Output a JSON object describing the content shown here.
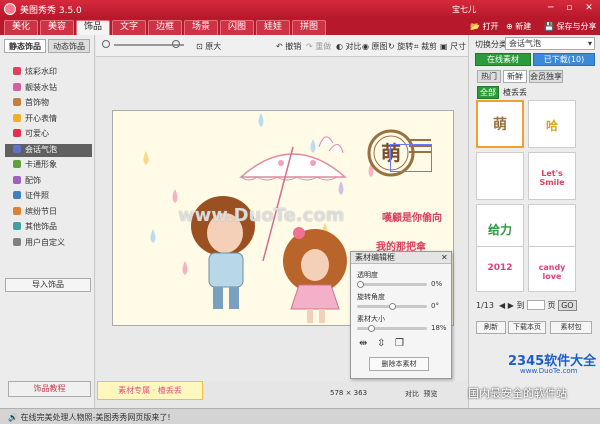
{
  "app": {
    "title": "美图秀秀 3.5.0",
    "user": "宝七儿",
    "win_controls": "─ ▫ ✕"
  },
  "menu": {
    "tabs": [
      "美化",
      "美容",
      "饰品",
      "文字",
      "边框",
      "场景",
      "闪图",
      "娃娃",
      "拼图"
    ],
    "active": 2,
    "open": "打开",
    "new": "新建",
    "save": "保存与分享"
  },
  "left": {
    "tab_static": "静态饰品",
    "tab_dynamic": "动态饰品",
    "categories": [
      {
        "label": "炫彩水印",
        "color": "#e04060"
      },
      {
        "label": "靓装水钻",
        "color": "#d060a0"
      },
      {
        "label": "首饰物",
        "color": "#c08040"
      },
      {
        "label": "开心表情",
        "color": "#f0b020"
      },
      {
        "label": "可爱心",
        "color": "#e03050"
      },
      {
        "label": "会话气泡",
        "color": "#6070d0"
      },
      {
        "label": "卡通形象",
        "color": "#60a040"
      },
      {
        "label": "配饰",
        "color": "#a060c0"
      },
      {
        "label": "证件照",
        "color": "#4080c0"
      },
      {
        "label": "缤纷节日",
        "color": "#e08030"
      },
      {
        "label": "其他饰品",
        "color": "#40a0a0"
      },
      {
        "label": "用户自定义",
        "color": "#808080"
      }
    ],
    "active_index": 5,
    "import": "导入饰品",
    "tutorial": "饰品教程",
    "banner": "素材专属 · 楂丢丢"
  },
  "toolbar": {
    "original": "原大",
    "undo": "撤销",
    "redo": "重做",
    "contrast": "对比",
    "original_view": "原图",
    "rotate": "旋转",
    "crop": "裁剪",
    "size": "尺寸"
  },
  "canvas": {
    "stamp_char": "萌",
    "text1": "嘆顧是你偷向",
    "text2": "我的那把傘",
    "watermark": "www.DuoTe.com"
  },
  "editor": {
    "title": "素材编辑框",
    "close": "✕",
    "opacity_label": "透明度",
    "opacity_value": "0%",
    "opacity": 0.0,
    "angle_label": "旋转角度",
    "angle_value": "0°",
    "angle": 0.5,
    "size_label": "素材大小",
    "size_value": "18%",
    "size": 0.18,
    "delete": "删除本素材"
  },
  "status": {
    "message": "在线完美处理人物照-美图秀秀网页版来了!",
    "coord": "578 × 363",
    "btn1": "对比",
    "btn2": "预览"
  },
  "right": {
    "switch_label": "切换分类",
    "switch_value": "会话气泡",
    "tab_online": "在线素材",
    "tab_downloaded": "已下载(10)",
    "subtabs": [
      "热门",
      "新鲜",
      "会员独享"
    ],
    "filter_all": "全部",
    "filter_tag": "楂丢丢",
    "thumbs": [
      "萌",
      "哈",
      "Let's Smile",
      "给力",
      "2012",
      "candy love"
    ],
    "page": "1/13",
    "goto": "到",
    "page_suffix": "页",
    "go": "GO",
    "refresh": "刷新",
    "download": "下载本页",
    "pack": "素材包"
  },
  "overlay": {
    "logo": "2345软件大全",
    "site": "www.DuoTe.com",
    "safe": "国内最安全的软件站"
  }
}
